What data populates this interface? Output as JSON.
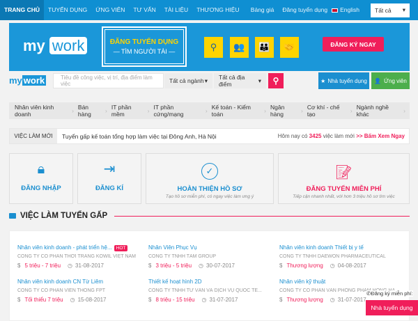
{
  "nav": {
    "items": [
      "TRANG CHỦ",
      "TUYỂN DỤNG",
      "ỨNG VIÊN",
      "TƯ VẤN",
      "TÀI LIỆU",
      "THƯƠNG HIỆU"
    ],
    "right": [
      "Bảng giá",
      "Đăng tuyển dụng",
      "English"
    ],
    "select": "Tất cả"
  },
  "banner": {
    "logo_my": "my",
    "logo_work": "work",
    "title": "ĐĂNG TUYỂN DỤNG",
    "subtitle": "— TÌM NGƯỜI TÀI —",
    "cta": "ĐĂNG KÝ NGAY"
  },
  "search": {
    "logo_my": "my",
    "logo_work": "work",
    "placeholder": "Tiêu đề công việc, vị trí, địa điểm làm việc",
    "industry": "Tất cả ngành",
    "location": "Tất cả địa điểm",
    "employer_btn": "Nhà tuyển dụng",
    "candidate_btn": "Ứng viên"
  },
  "categories": [
    "Nhân viên kinh doanh",
    "Bán hàng",
    "IT phần mềm",
    "IT phần cứng/mạng",
    "Kế toán - Kiểm toán",
    "Ngân hàng",
    "Cơ khí - chế tạo",
    "Ngành nghề khác"
  ],
  "news": {
    "label": "VIỆC LÀM MỚI",
    "headline": "Tuyển gấp kế toán tổng hợp làm việc tại Đông Anh, Hà Nội",
    "prefix": "Hôm nay có",
    "count": "3425",
    "suffix": "việc làm mới",
    "link": ">> Bấm Xem Ngay"
  },
  "cards": [
    {
      "title": "ĐĂNG NHẬP"
    },
    {
      "title": "ĐĂNG KÍ"
    },
    {
      "title": "HOÀN THIỆN HỒ SƠ",
      "sub": "Tạo hồ sơ miễn phí, có ngay việc làm ưng ý"
    },
    {
      "title": "ĐĂNG TUYỂN MIỄN PHÍ",
      "sub": "Tiếp cận nhanh nhất, với hơn 3 triệu hồ sơ tìm việc"
    }
  ],
  "section": {
    "title": "VIỆC LÀM TUYỂN GẤP"
  },
  "jobs": [
    {
      "title": "Nhân viên kinh doanh - phát triển hệ...",
      "hot": "HOT",
      "company": "CÔNG TY CỔ PHẦN THỜI TRANG KOWIL VIỆT NAM",
      "salary": "5 triệu - 7 triệu",
      "date": "31-08-2017"
    },
    {
      "title": "Nhân Viên Phục Vụ",
      "company": "CÔNG TY TNHH TÂM GROUP",
      "salary": "3 triệu - 5 triệu",
      "date": "30-07-2017"
    },
    {
      "title": "Nhân viên kinh doanh Thiết bị y tế",
      "company": "CÔNG TY TNHH DAEWON PHARMACEUTICAL",
      "salary": "Thương lượng",
      "date": "04-08-2017"
    },
    {
      "title": "Nhân viên kinh doanh CN Từ Liêm",
      "company": "CÔNG TY CỔ PHẦN VIỄN THÔNG FPT",
      "salary": "Tối thiểu 7 triệu",
      "date": "15-08-2017"
    },
    {
      "title": "Thiết kế hoạt hình 2D",
      "company": "CÔNG TY TNHH TƯ VẤN VÀ DỊCH VỤ QUỐC TẾ...",
      "salary": "8 triệu - 15 triệu",
      "date": "31-07-2017"
    },
    {
      "title": "Nhân viên kỹ thuật",
      "company": "CÔNG TY CỔ PHẦN VĂN PHÒNG PHẨM HỒNG HÀ",
      "salary": "Thương lượng",
      "date": "31-07-2017"
    }
  ],
  "floating": {
    "label": "Đăng ký miễn phí:",
    "button": "Nhà tuyển dụng"
  }
}
